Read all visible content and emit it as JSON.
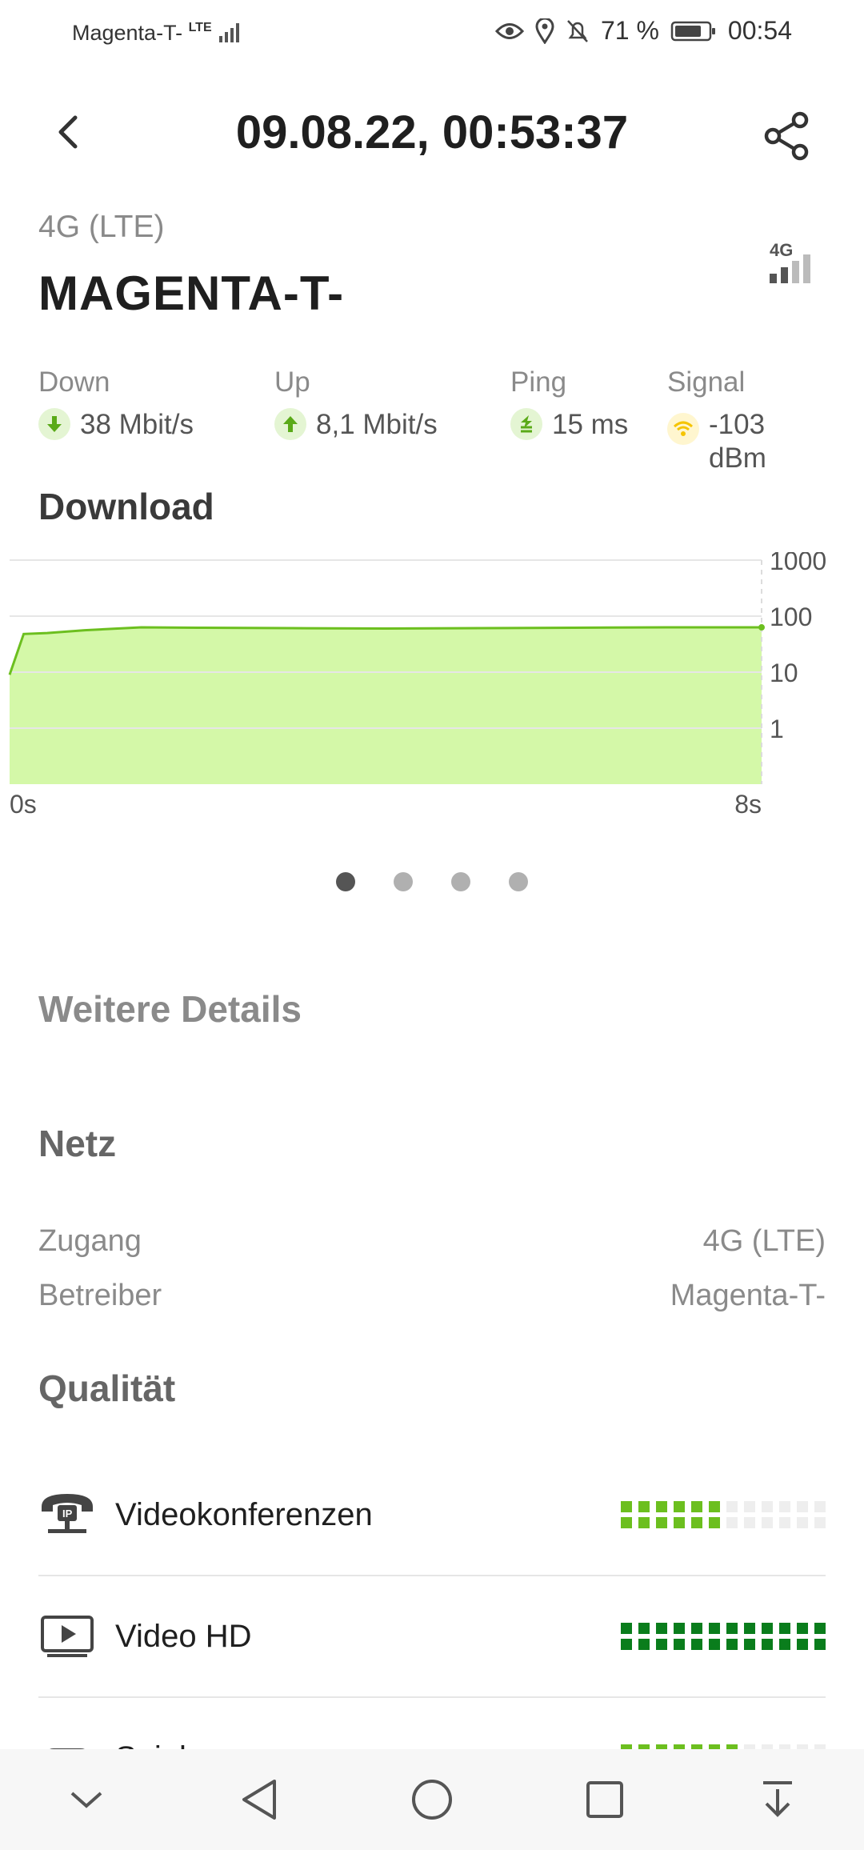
{
  "status_bar": {
    "carrier": "Magenta-T-",
    "network_badge": "LTE",
    "battery": "71 %",
    "time": "00:54"
  },
  "header": {
    "title": "09.08.22, 00:53:37",
    "back_icon": "chevron-left-icon",
    "share_icon": "share-icon"
  },
  "connection": {
    "technology": "4G (LTE)",
    "operator": "MAGENTA-T-",
    "badge": "4G"
  },
  "metrics": [
    {
      "label": "Down",
      "value": "38 Mbit/s",
      "icon": "arrow-down-icon"
    },
    {
      "label": "Up",
      "value": "8,1 Mbit/s",
      "icon": "arrow-up-icon"
    },
    {
      "label": "Ping",
      "value": "15 ms",
      "icon": "ping-icon"
    },
    {
      "label": "Signal",
      "value": "-103 dBm",
      "value_line1": "-103",
      "value_line2": "dBm",
      "icon": "wifi-signal-icon"
    }
  ],
  "download_section": {
    "title": "Download"
  },
  "chart_data": {
    "type": "area",
    "title": "Download",
    "xlabel": "",
    "ylabel": "",
    "y_scale": "log",
    "ylim": [
      0.1,
      1000
    ],
    "y_ticks": [
      "1000",
      "100",
      "10",
      "1"
    ],
    "x_ticks": [
      "0s",
      "8s"
    ],
    "xlim": [
      0,
      8
    ],
    "grid": true,
    "series": [
      {
        "x": [
          0,
          0.15,
          0.4,
          0.8,
          1.4,
          2,
          3,
          4,
          5,
          6,
          7,
          8
        ],
        "values": [
          9,
          48,
          50,
          56,
          63,
          62,
          61,
          60,
          61,
          62,
          63,
          63
        ]
      }
    ]
  },
  "pager": {
    "count": 4,
    "active_index": 0
  },
  "details": {
    "title": "Weitere Details",
    "network_title": "Netz",
    "rows": [
      {
        "key": "Zugang",
        "value": "4G (LTE)"
      },
      {
        "key": "Betreiber",
        "value": "Magenta-T-"
      }
    ]
  },
  "quality": {
    "title": "Qualität",
    "items": [
      {
        "label": "Videokonferenzen",
        "icon": "video-conference-phone-icon",
        "filled": 6,
        "total": 12,
        "color": "#6cbf1f"
      },
      {
        "label": "Video HD",
        "icon": "video-play-icon",
        "filled": 12,
        "total": 12,
        "color": "#0a7d1c"
      },
      {
        "label": "Spiele",
        "icon": "gamepad-icon",
        "filled": 7,
        "total": 12,
        "color": "#6cbf1f"
      }
    ]
  },
  "navbar": {
    "items": [
      "collapse-icon",
      "back-triangle-icon",
      "home-circle-icon",
      "recents-square-icon",
      "notification-pull-icon"
    ]
  },
  "colors": {
    "accent_green": "#6cbf1f",
    "area_fill": "#d4f8a8",
    "dark_green": "#0a7d1c",
    "signal_yellow": "#f5c400"
  }
}
